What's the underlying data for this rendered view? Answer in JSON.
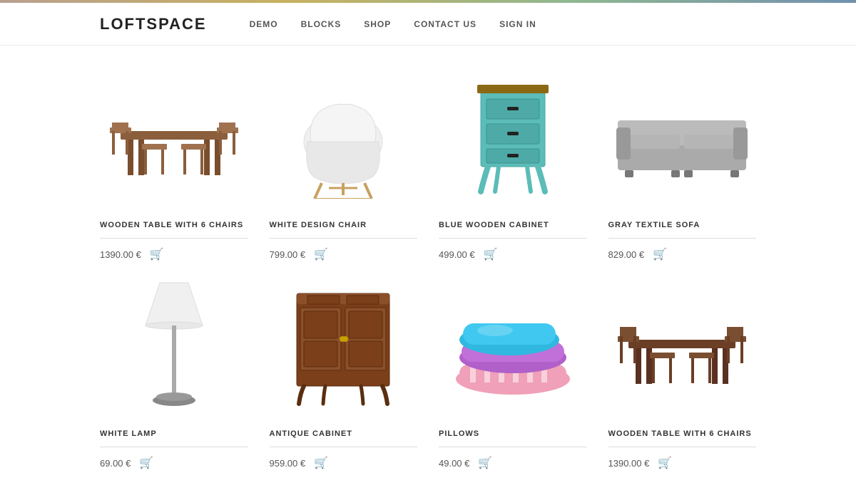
{
  "topbar": {},
  "header": {
    "logo": "LOFTSPACE",
    "nav": [
      {
        "label": "DEMO",
        "id": "demo"
      },
      {
        "label": "BLOCKS",
        "id": "blocks"
      },
      {
        "label": "SHOP",
        "id": "shop"
      },
      {
        "label": "CONTACT US",
        "id": "contact"
      },
      {
        "label": "SIGN IN",
        "id": "signin"
      }
    ]
  },
  "products": [
    {
      "id": "wooden-table-6chairs-1",
      "name": "WOODEN TABLE WITH 6 CHAIRS",
      "price": "1390.00 €",
      "color": "brown",
      "type": "table-chairs"
    },
    {
      "id": "white-design-chair",
      "name": "WHITE DESIGN CHAIR",
      "price": "799.00 €",
      "color": "white",
      "type": "chair"
    },
    {
      "id": "blue-wooden-cabinet",
      "name": "BLUE WOODEN CABINET",
      "price": "499.00 €",
      "color": "teal",
      "type": "cabinet"
    },
    {
      "id": "gray-textile-sofa",
      "name": "GRAY TEXTILE SOFA",
      "price": "829.00 €",
      "color": "gray",
      "type": "sofa"
    },
    {
      "id": "white-lamp",
      "name": "WHITE LAMP",
      "price": "69.00 €",
      "color": "white",
      "type": "lamp"
    },
    {
      "id": "antique-cabinet",
      "name": "ANTIQUE CABINET",
      "price": "959.00 €",
      "color": "brown",
      "type": "antique-cabinet"
    },
    {
      "id": "pillows",
      "name": "PILLOWS",
      "price": "49.00 €",
      "color": "multicolor",
      "type": "pillows"
    },
    {
      "id": "wooden-table-6chairs-2",
      "name": "WOODEN TABLE WITH 6 CHAIRS",
      "price": "1390.00 €",
      "color": "brown",
      "type": "table-chairs"
    }
  ],
  "icons": {
    "cart": "🛒"
  }
}
